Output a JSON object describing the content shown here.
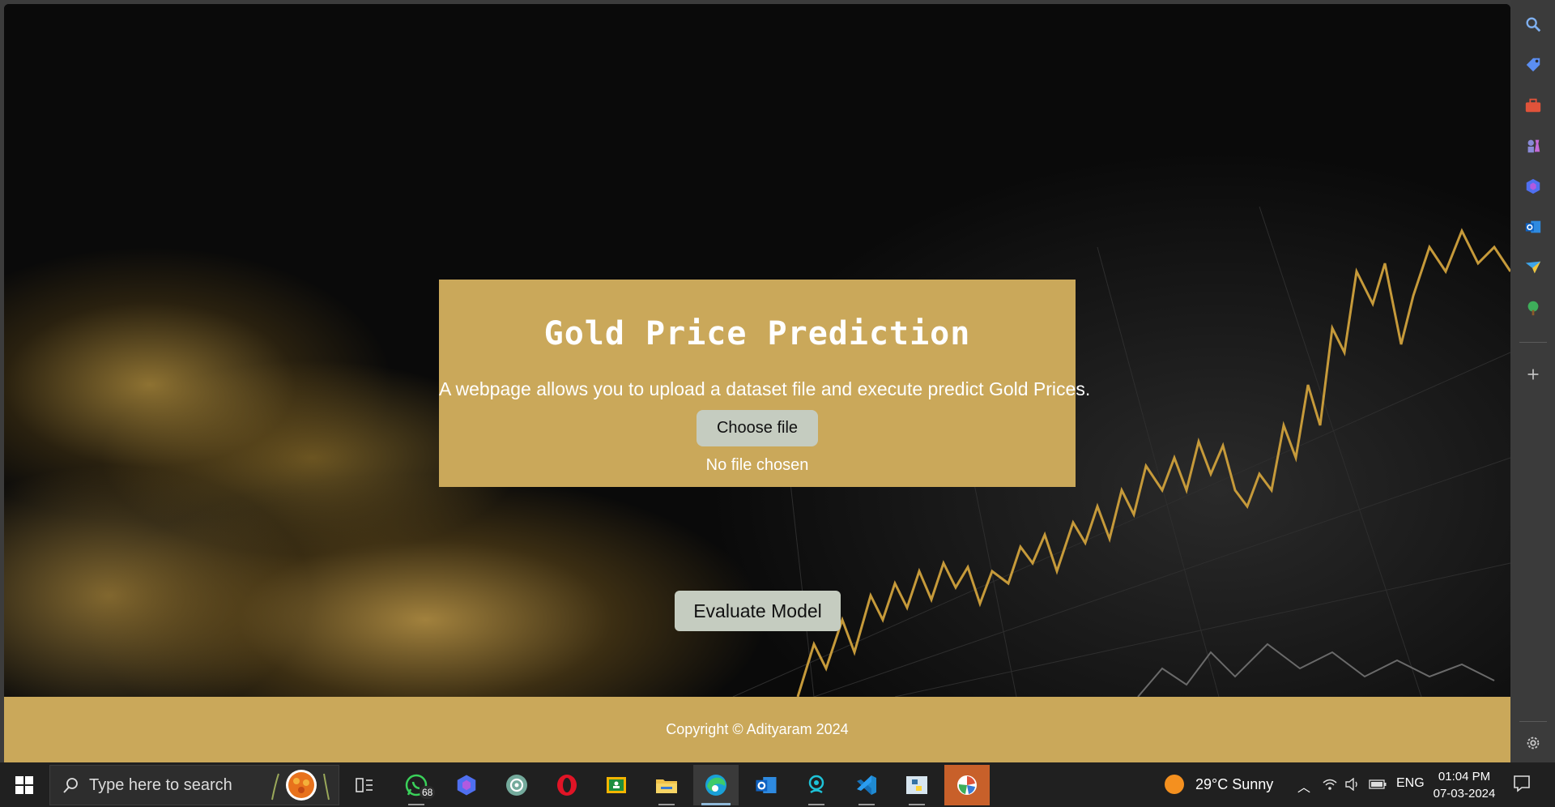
{
  "page": {
    "title": "Gold Price Prediction",
    "subtitle": "A webpage allows you to upload a dataset file and execute predict Gold Prices.",
    "choose_file_label": "Choose file",
    "file_status": "No file chosen",
    "evaluate_label": "Evaluate Model",
    "copyright": "Copyright © Adityaram 2024"
  },
  "colors": {
    "card_bg": "#caa85a",
    "button_bg": "#c5ccc0",
    "footer_bg": "#caa85a"
  },
  "edge_sidebar": {
    "items": [
      "search-icon",
      "tag-icon",
      "toolbox-icon",
      "chess-icon",
      "copilot-icon",
      "outlook-icon",
      "telegram-icon",
      "tree-icon",
      "plus-icon",
      "gear-icon"
    ]
  },
  "taskbar": {
    "search_placeholder": "Type here to search",
    "whatsapp_badge": "68",
    "apps": [
      "whatsapp-icon",
      "copilot-icon",
      "chatgpt-icon",
      "opera-icon",
      "classroom-icon",
      "file-explorer-icon",
      "edge-icon",
      "outlook-icon",
      "snipping-icon",
      "vscode-icon",
      "python-idle-icon",
      "app-icon"
    ],
    "weather": "29°C  Sunny",
    "language": "ENG",
    "time": "01:04 PM",
    "date": "07-03-2024"
  }
}
